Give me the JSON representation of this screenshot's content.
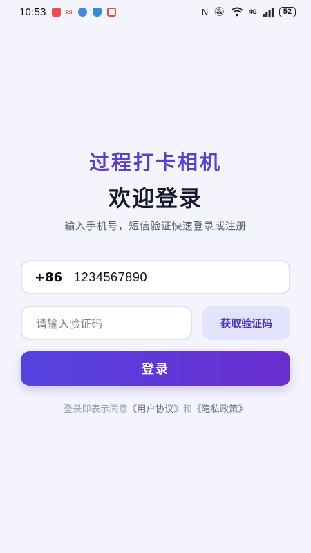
{
  "status_bar": {
    "time": "10:53",
    "network": "4G",
    "battery": "52",
    "notification_icons": [
      "red-app-icon",
      "mail-app-icon",
      "blue-app-icon",
      "shield-app-icon",
      "calendar-app-icon"
    ],
    "system_icons": [
      "nfc-icon",
      "mute-icon",
      "wifi-icon",
      "signal-icon"
    ]
  },
  "header": {
    "app_title": "过程打卡相机",
    "welcome": "欢迎登录",
    "subtitle": "输入手机号，短信验证快速登录或注册"
  },
  "form": {
    "country_code": "+86",
    "phone_value": "1234567890",
    "code_placeholder": "请输入验证码",
    "get_code_label": "获取验证码",
    "login_label": "登录"
  },
  "agreement": {
    "prefix": "登录即表示同意",
    "user_agreement": "《用户协议》",
    "conjunction": "和",
    "privacy_policy": "《隐私政策》"
  },
  "colors": {
    "accent": "#5b3fd1",
    "button_gradient_start": "#5543df",
    "button_gradient_end": "#6a2ed0",
    "background": "#f3f4fc"
  }
}
